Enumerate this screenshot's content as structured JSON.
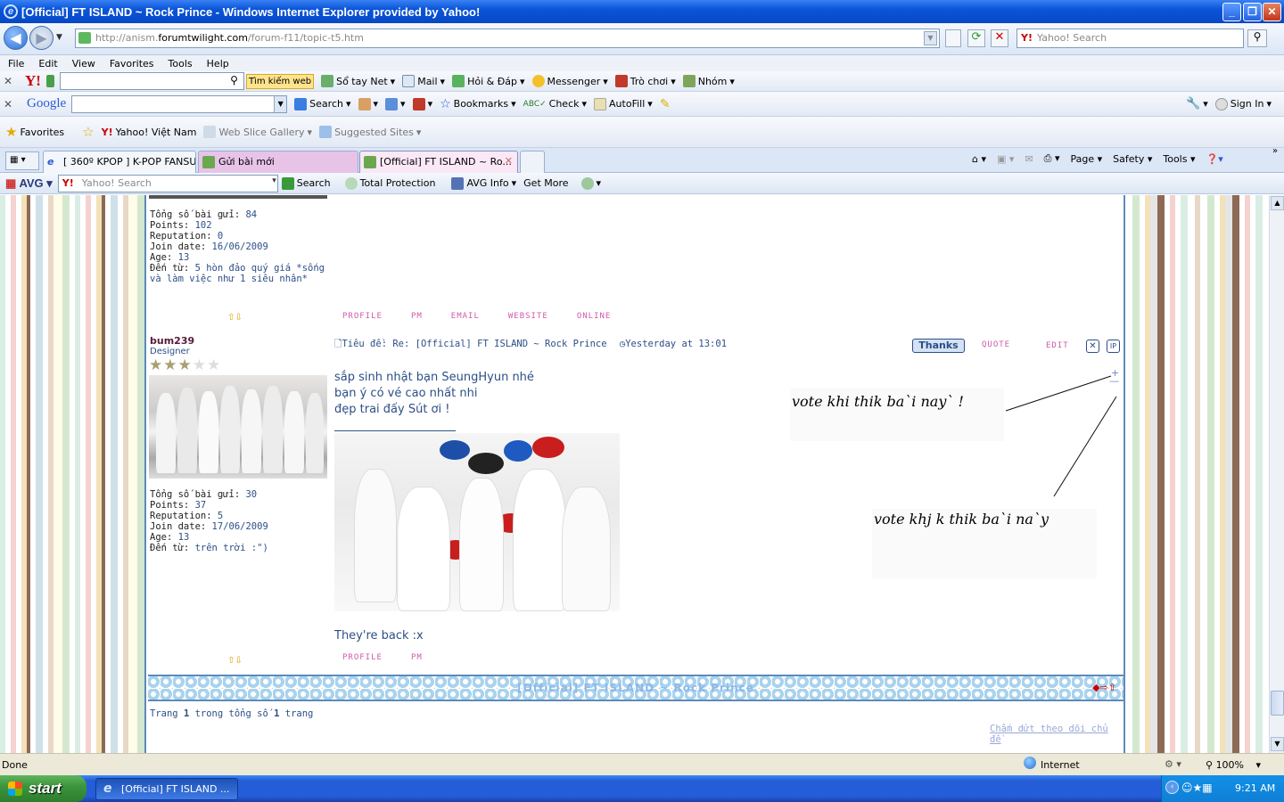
{
  "window": {
    "title": "[Official] FT ISLAND ~ Rock Prince - Windows Internet Explorer provided by Yahoo!",
    "minimize": "_",
    "restore": "❐",
    "close": "✕"
  },
  "address": {
    "url_prefix": "http://anism.",
    "url_domain": "forumtwilight.com",
    "url_path": "/forum-f11/topic-t5.htm",
    "search_placeholder": "Yahoo! Search"
  },
  "menu": [
    "File",
    "Edit",
    "View",
    "Favorites",
    "Tools",
    "Help"
  ],
  "yahoo_toolbar": {
    "search_web": "Tìm kiếm web",
    "items": [
      "Sổ tay Net",
      "Mail",
      "Hỏi & Đáp",
      "Messenger",
      "Trò chơi",
      "Nhóm"
    ]
  },
  "google_toolbar": {
    "logo": "Google",
    "search": "Search",
    "bookmarks": "Bookmarks",
    "check": "Check",
    "autofill": "AutoFill",
    "sign_in": "Sign In"
  },
  "favorites_bar": {
    "favorites": "Favorites",
    "items": [
      "Yahoo! Việt Nam",
      "Web Slice Gallery",
      "Suggested Sites"
    ]
  },
  "tabs": [
    {
      "label": "[ 360º KPOP ] K-POP FANSU..."
    },
    {
      "label": "Gửi bài mới"
    },
    {
      "label": "[Official] FT ISLAND ~ Ro..."
    }
  ],
  "command_bar": {
    "page": "Page",
    "safety": "Safety",
    "tools": "Tools"
  },
  "avg_bar": {
    "logo": "AVG",
    "search_placeholder": "Yahoo! Search",
    "search": "Search",
    "total_protection": "Total Protection",
    "avg_info": "AVG Info",
    "get_more": "Get More"
  },
  "user1": {
    "posts_label": "Tổng số bài gửi:",
    "posts": "84",
    "points_label": "Points:",
    "points": "102",
    "rep_label": "Reputation:",
    "rep": "0",
    "join_label": "Join date:",
    "join": "16/06/2009",
    "age_label": "Age:",
    "age": "13",
    "from_label": "Đến từ:",
    "from": "5 hòn đảo quý giá *sống và làm việc như 1 siêu nhân*"
  },
  "links1": [
    "profile",
    "pm",
    "email",
    "website",
    "online"
  ],
  "post2": {
    "username": "bum239",
    "rank": "Designer",
    "subject_label": "Tiêu đề:",
    "subject": "Re: [Official] FT ISLAND ~ Rock Prince",
    "time": "Yesterday at 13:01",
    "thanks": "Thanks",
    "quote": "quote",
    "edit": "edit",
    "lines": [
      "sắp sinh nhật bạn SeungHyun nhé",
      "bạn ý có vé cao nhất nhi",
      "đẹp trai đấy Sút ơi !"
    ],
    "footer_text": "They're back :x",
    "annotation1": "vote khi thik ba`i nay` !",
    "annotation2": "vote khj k thik ba`i na`y",
    "plus": "+",
    "minus": "—"
  },
  "user2": {
    "posts_label": "Tổng số bài gửi:",
    "posts": "30",
    "points_label": "Points:",
    "points": "37",
    "rep_label": "Reputation:",
    "rep": "5",
    "join_label": "Join date:",
    "join": "17/06/2009",
    "age_label": "Age:",
    "age": "13",
    "from_label": "Đến từ:",
    "from": "trên trời :\")"
  },
  "links2": [
    "profile",
    "pm"
  ],
  "topic_bar": {
    "title": "[Official] FT ISLAND ~ Rock Prince"
  },
  "pagination": {
    "prefix": "Trang",
    "page": "1",
    "middle": "trong tổng số",
    "total": "1",
    "suffix": "trang"
  },
  "unwatch": "Chấm dứt theo dõi chủ đề",
  "status": {
    "left": "Done",
    "zone": "Internet",
    "zoom": "100%"
  },
  "taskbar": {
    "start": "start",
    "item": "[Official] FT ISLAND ...",
    "clock": "9:21 AM"
  },
  "colors": {
    "accent": "#245dd7",
    "forum_border": "#5e8ab8",
    "link_pink": "#d05aa9",
    "text_blue": "#2c4f87"
  }
}
